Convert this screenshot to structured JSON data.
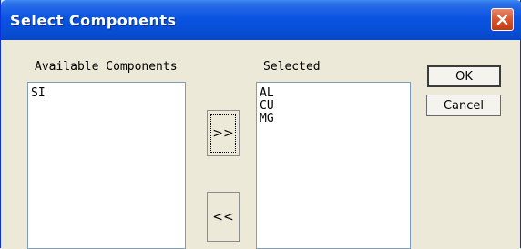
{
  "window": {
    "title": "Select Components"
  },
  "available": {
    "label": "Available Components",
    "items": [
      "SI"
    ]
  },
  "selected": {
    "label": "Selected",
    "items": [
      "AL",
      "CU",
      "MG"
    ]
  },
  "buttons": {
    "add_label": ">>",
    "remove_label": "<<",
    "ok_label": "OK",
    "cancel_label": "Cancel"
  },
  "icons": {
    "close": "close-icon"
  },
  "colors": {
    "titlebar": "#0a54e3",
    "close_button": "#d9592f",
    "dialog_background": "#ece9d8"
  }
}
